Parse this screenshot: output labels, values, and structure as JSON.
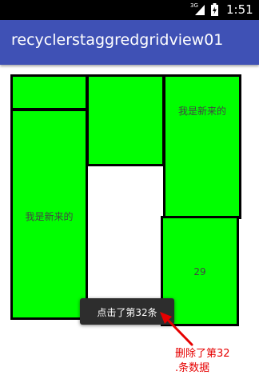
{
  "status_bar": {
    "network": "3G",
    "time": "1:51",
    "icons": [
      "signal-icon",
      "battery-charging-icon"
    ]
  },
  "app_bar": {
    "title": "recyclerstaggredgridview01",
    "color": "#3f51b5"
  },
  "grid": {
    "cell_color": "#00ff00",
    "items": [
      {
        "label": ""
      },
      {
        "label": ""
      },
      {
        "label": "我是新来的"
      },
      {
        "label": "我是新来的"
      },
      {
        "label": "29"
      }
    ]
  },
  "toast": {
    "text": "点击了第32条"
  },
  "annotation": {
    "line1": "删除了第32",
    "line2": ".条数据",
    "color": "#e60000"
  }
}
